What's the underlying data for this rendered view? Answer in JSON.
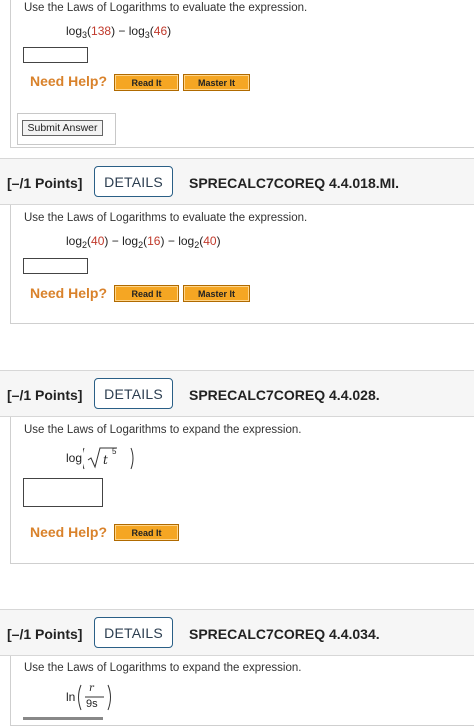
{
  "q1": {
    "prompt": "Use the Laws of Logarithms to evaluate the expression.",
    "expr": {
      "log": "log",
      "base": "3",
      "arg1": "138",
      "minus": "−",
      "arg2": "46"
    },
    "need_help": "Need Help?",
    "read_it": "Read It",
    "master_it": "Master It",
    "submit": "Submit Answer"
  },
  "q2": {
    "points": "[–/1 Points]",
    "details": "DETAILS",
    "code": "SPRECALC7COREQ 4.4.018.MI.",
    "prompt": "Use the Laws of Logarithms to evaluate the expression.",
    "expr": {
      "log": "log",
      "base": "2",
      "arg1": "40",
      "arg2": "16",
      "arg3": "40",
      "minus": "−"
    },
    "need_help": "Need Help?",
    "read_it": "Read It",
    "master_it": "Master It"
  },
  "q3": {
    "points": "[–/1 Points]",
    "details": "DETAILS",
    "code": "SPRECALC7COREQ 4.4.028.",
    "prompt": "Use the Laws of Logarithms to expand the expression.",
    "expr": {
      "log": "log",
      "var": "t",
      "exp": "5"
    },
    "need_help": "Need Help?",
    "read_it": "Read It"
  },
  "q4": {
    "points": "[–/1 Points]",
    "details": "DETAILS",
    "code": "SPRECALC7COREQ 4.4.034.",
    "prompt": "Use the Laws of Logarithms to expand the expression.",
    "expr": {
      "ln": "ln",
      "num": "r",
      "den": "9s"
    }
  },
  "colors": {
    "need_help": "#d9822b",
    "button_orange": "#f5a623",
    "details_border": "#2a5f86",
    "red_number": "#c0392b"
  }
}
